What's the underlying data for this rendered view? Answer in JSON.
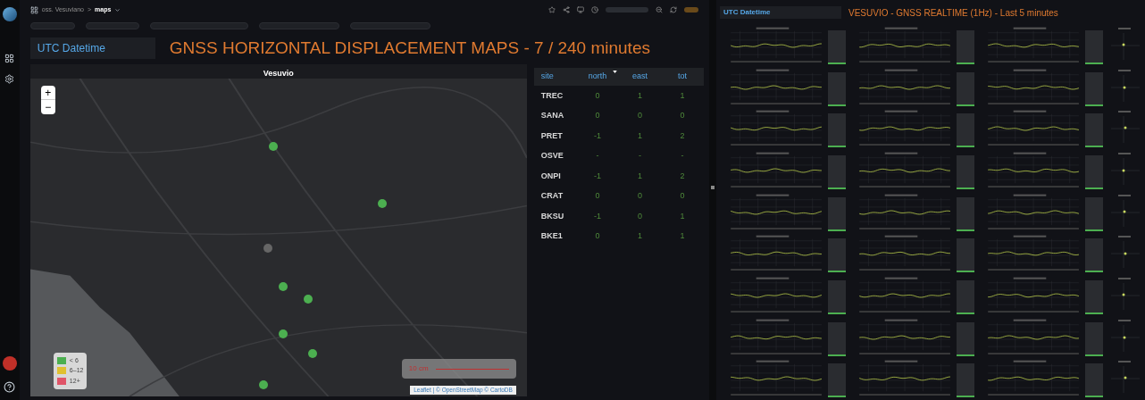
{
  "breadcrumb": {
    "folder": "oss. Vesuviano",
    "separator": ">",
    "page": "maps"
  },
  "left_panel": {
    "datetime_label": "UTC Datetime",
    "title": "GNSS HORIZONTAL DISPLACEMENT MAPS - 7 / 240 minutes"
  },
  "map": {
    "title": "Vesuvio",
    "zoom_in": "+",
    "zoom_out": "−",
    "scale": "10 cm",
    "attribution": "Leaflet | © OpenStreetMap © CartoDB",
    "legend": [
      {
        "label": "< 6",
        "color": "#4caf50"
      },
      {
        "label": "6–12",
        "color": "#e0c030"
      },
      {
        "label": "12+",
        "color": "#e05468"
      }
    ]
  },
  "table": {
    "columns": [
      {
        "label": "site",
        "sorted": false
      },
      {
        "label": "north",
        "sorted": true
      },
      {
        "label": "east",
        "sorted": false
      },
      {
        "label": "tot",
        "sorted": false
      }
    ],
    "rows": [
      [
        "TREC",
        "0",
        "1",
        "1"
      ],
      [
        "SANA",
        "0",
        "0",
        "0"
      ],
      [
        "PRET",
        "-1",
        "1",
        "2"
      ],
      [
        "OSVE",
        "-",
        "-",
        "-"
      ],
      [
        "ONPI",
        "-1",
        "1",
        "2"
      ],
      [
        "CRAT",
        "0",
        "0",
        "0"
      ],
      [
        "BKSU",
        "-1",
        "0",
        "1"
      ],
      [
        "BKE1",
        "0",
        "1",
        "1"
      ]
    ]
  },
  "right_panel": {
    "datetime_label": "UTC Datetime",
    "title": "VESUVIO - GNSS REALTIME (1Hz) - Last 5 minutes"
  }
}
